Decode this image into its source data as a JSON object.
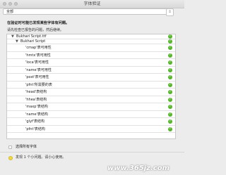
{
  "window": {
    "title": "字体验证"
  },
  "filter": {
    "selected": "全部"
  },
  "heading": "在验证时可能已发现某些字体有问题。",
  "subheading": "请先检查已报告的问题，然后继续。",
  "tree": {
    "file": "Bukhari Script.ttf",
    "font": "Bukhari Script",
    "items": [
      {
        "label": "'cmap'表可用性",
        "status": "ok"
      },
      {
        "label": "'hmtx'表可用性",
        "status": "ok"
      },
      {
        "label": "'loca'表可用性",
        "status": "ok"
      },
      {
        "label": "'name'表可用性",
        "status": "ok"
      },
      {
        "label": "'post'表可用性",
        "status": "ok"
      },
      {
        "label": "'pfnt'所需要的表",
        "status": "ok"
      },
      {
        "label": "'head'表结构",
        "status": "ok"
      },
      {
        "label": "'hhea'表结构",
        "status": "ok"
      },
      {
        "label": "'maxp'表结构",
        "status": "ok"
      },
      {
        "label": "'name'表结构",
        "status": "ok"
      },
      {
        "label": "'glyf'表结构",
        "status": "ok"
      },
      {
        "label": "'pfnt'表结构",
        "status": "ok"
      }
    ]
  },
  "options": {
    "select_all_label": "选择所有字体"
  },
  "status": {
    "message": "发现 1 个小问题。请小心使用。"
  },
  "watermark": "www.365jz.com",
  "colors": {
    "ok": "#56b52c",
    "warning": "#f3d844"
  }
}
